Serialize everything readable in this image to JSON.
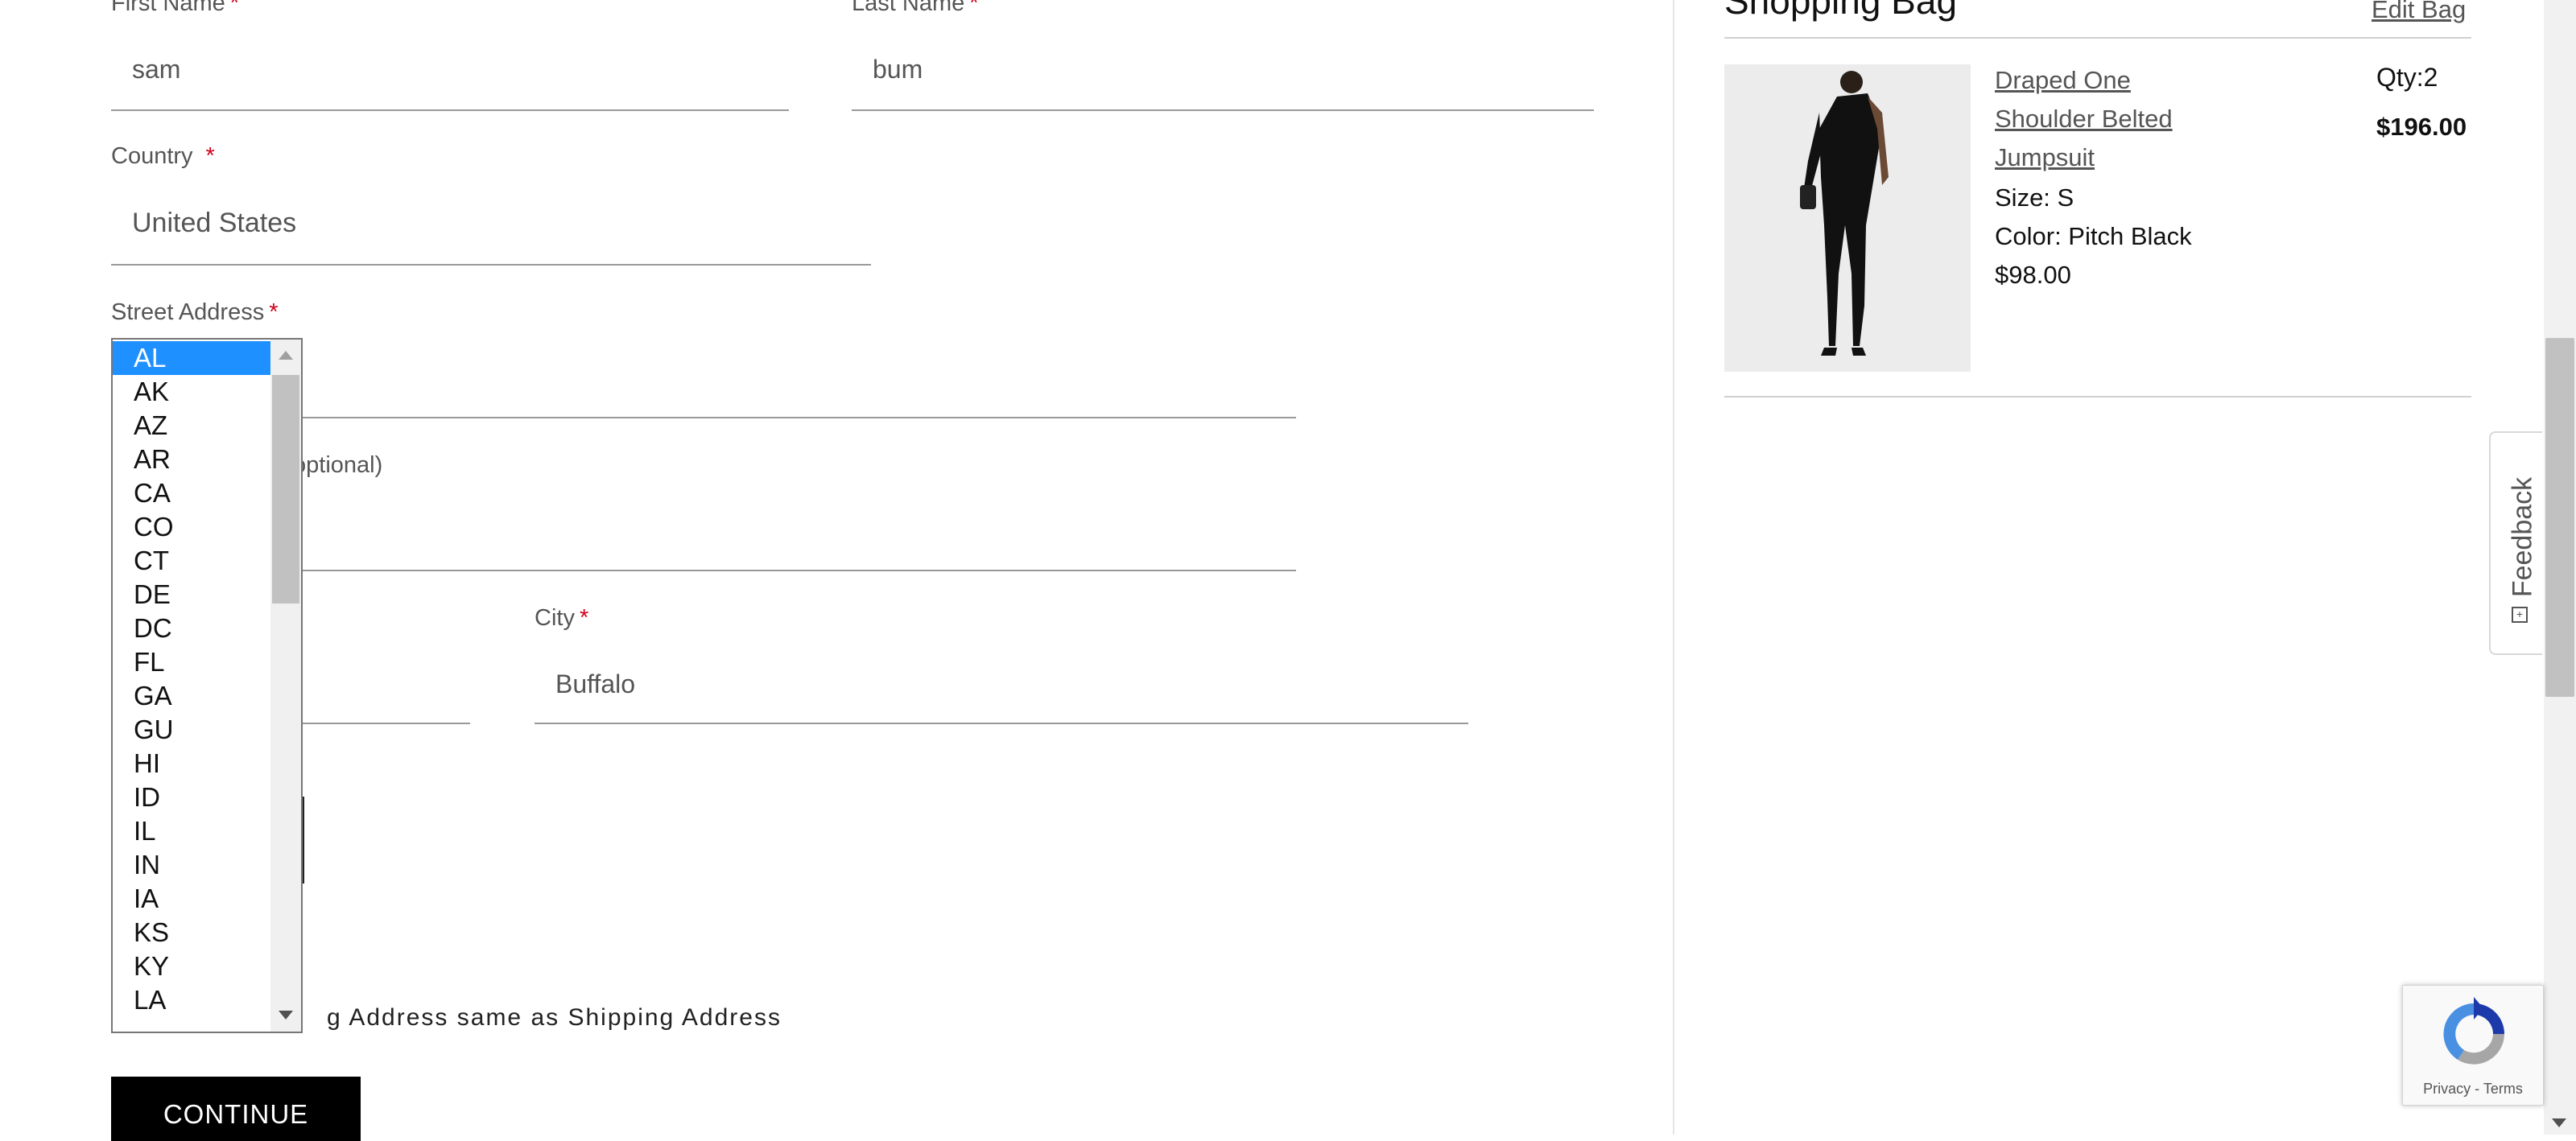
{
  "form": {
    "first_name": {
      "label": "First Name",
      "required_mark": "*",
      "value": "sam"
    },
    "last_name": {
      "label": "Last Name",
      "required_mark": "*",
      "value": "bum"
    },
    "country": {
      "label": "Country",
      "required_mark": "*",
      "value": "United States"
    },
    "street_address": {
      "label": "Street Address",
      "required_mark": "*"
    },
    "address_line2_label_partial": "optional)",
    "city": {
      "label": "City",
      "required_mark": "*",
      "value": "Buffalo"
    },
    "billing_same_label_partial": "g Address same as Shipping Address",
    "continue_label": "CONTINUE"
  },
  "state_dropdown": {
    "selected": "AL",
    "options": [
      "AL",
      "AK",
      "AZ",
      "AR",
      "CA",
      "CO",
      "CT",
      "DE",
      "DC",
      "FL",
      "GA",
      "GU",
      "HI",
      "ID",
      "IL",
      "IN",
      "IA",
      "KS",
      "KY",
      "LA"
    ]
  },
  "bag": {
    "title_partial": "Shopping Bag",
    "edit_label": "Edit Bag",
    "item": {
      "name_line1": "Draped One",
      "name_line2": "Shoulder Belted",
      "name_line3": "Jumpsuit",
      "size": "Size: S",
      "color": "Color: Pitch Black",
      "price": "$98.00",
      "qty": "Qty:2",
      "total": "$196.00"
    }
  },
  "feedback": {
    "label": "Feedback"
  },
  "recaptcha": {
    "links": "Privacy - Terms"
  },
  "colors": {
    "selected_option": "#1e90ff",
    "required": "#d0021b",
    "button": "#000000"
  }
}
